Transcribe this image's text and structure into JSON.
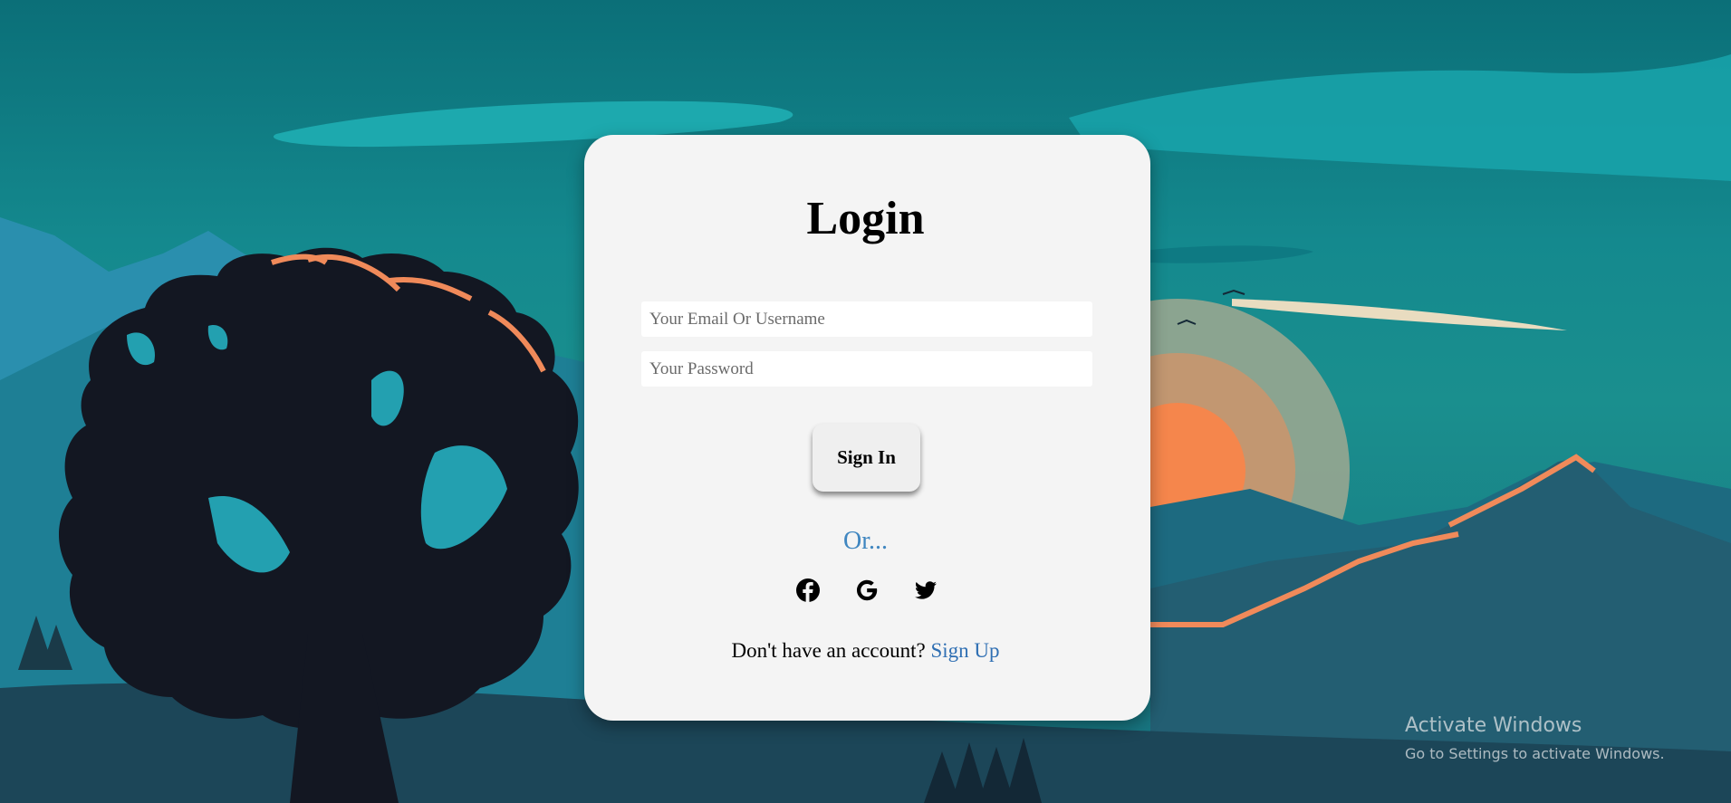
{
  "login": {
    "title": "Login",
    "email_placeholder": "Your Email Or Username",
    "password_placeholder": "Your Password",
    "signin_label": "Sign In",
    "or_text": "Or...",
    "social": [
      {
        "icon": "facebook-icon"
      },
      {
        "icon": "google-icon"
      },
      {
        "icon": "twitter-icon"
      }
    ],
    "signup_prompt": "Don't have an account?",
    "signup_link": "Sign Up"
  },
  "watermark": {
    "title": "Activate Windows",
    "subtitle": "Go to Settings to activate Windows."
  },
  "colors": {
    "card_bg": "#f4f4f4",
    "link": "#2f6fb3",
    "or_text": "#3f86c0",
    "sky": "#14898e",
    "tree": "#131722",
    "sun": "#f5864c"
  }
}
